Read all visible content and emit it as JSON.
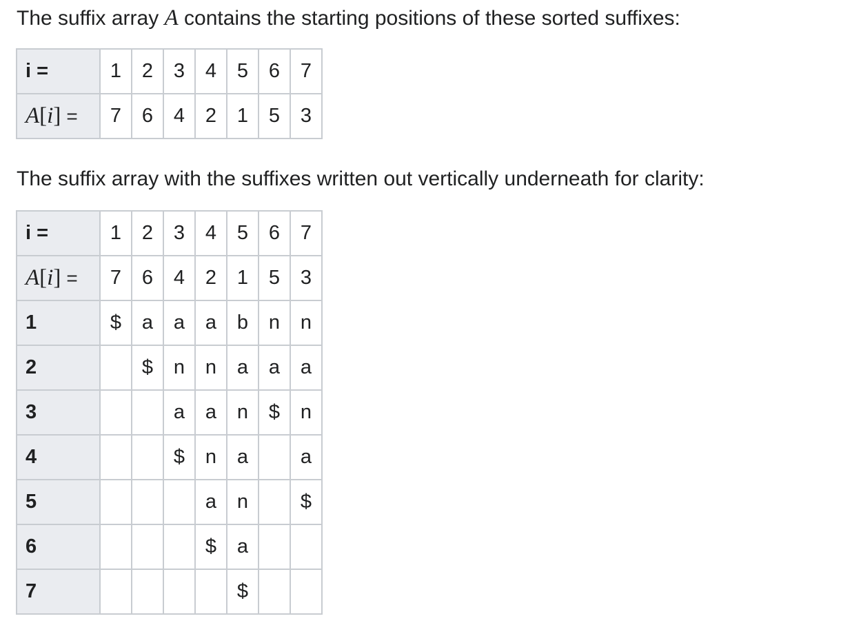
{
  "para1": {
    "before": "The suffix array ",
    "var": "A",
    "after": " contains the starting positions of these sorted suffixes:"
  },
  "para2": "The suffix array with the suffixes written out vertically underneath for clarity:",
  "header_i": "i =",
  "header_ai": {
    "var": "A",
    "open": "[",
    "index": "i",
    "close": "]",
    "eq": "="
  },
  "i_values": [
    "1",
    "2",
    "3",
    "4",
    "5",
    "6",
    "7"
  ],
  "a_values": [
    "7",
    "6",
    "4",
    "2",
    "1",
    "5",
    "3"
  ],
  "suffix_rows": [
    {
      "label": "1",
      "cells": [
        "$",
        "a",
        "a",
        "a",
        "b",
        "n",
        "n"
      ]
    },
    {
      "label": "2",
      "cells": [
        "",
        "$",
        "n",
        "n",
        "a",
        "a",
        "a"
      ]
    },
    {
      "label": "3",
      "cells": [
        "",
        "",
        "a",
        "a",
        "n",
        "$",
        "n"
      ]
    },
    {
      "label": "4",
      "cells": [
        "",
        "",
        "$",
        "n",
        "a",
        "",
        "a"
      ]
    },
    {
      "label": "5",
      "cells": [
        "",
        "",
        "",
        "a",
        "n",
        "",
        "$"
      ]
    },
    {
      "label": "6",
      "cells": [
        "",
        "",
        "",
        "$",
        "a",
        "",
        ""
      ]
    },
    {
      "label": "7",
      "cells": [
        "",
        "",
        "",
        "",
        "$",
        "",
        ""
      ]
    }
  ]
}
